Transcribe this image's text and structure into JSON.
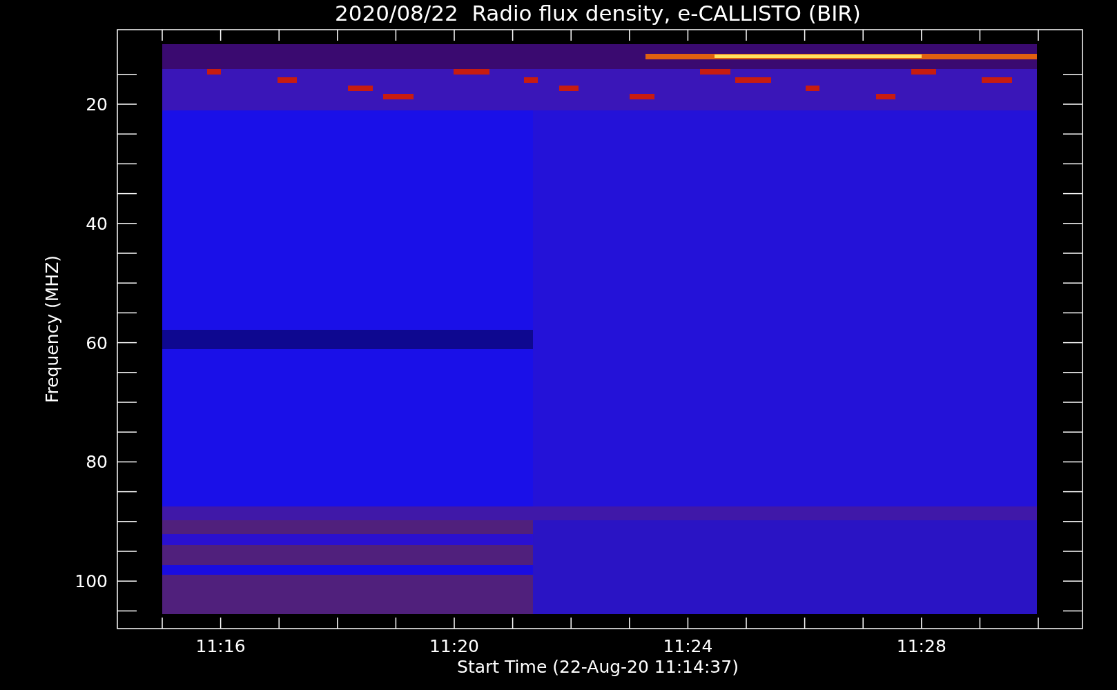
{
  "title": "2020/08/22  Radio flux density, e-CALLISTO (BIR)",
  "plot": {
    "ylabel": "Frequency (MHZ)",
    "xlabel": "Start Time (22-Aug-20 11:14:37)",
    "yticks": [
      "20",
      "40",
      "60",
      "80",
      "100"
    ],
    "xticks": [
      "11:16",
      "11:20",
      "11:24",
      "11:28"
    ]
  }
}
